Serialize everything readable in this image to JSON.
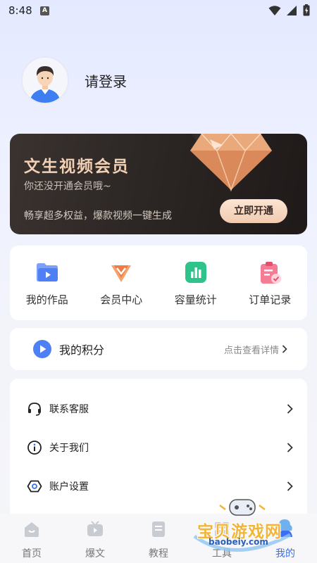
{
  "status_bar": {
    "time": "8:48",
    "notification_badge": "A"
  },
  "profile": {
    "login_text": "请登录"
  },
  "vip_card": {
    "title": "文生视频会员",
    "subtitle": "你还没开通会员哦~",
    "description": "畅享超多权益，爆款视频一键生成",
    "button_label": "立即开通"
  },
  "shortcuts": [
    {
      "label": "我的作品",
      "icon": "folder-video-icon",
      "color": "#5b86f7"
    },
    {
      "label": "会员中心",
      "icon": "vip-v-icon",
      "color": "#f07b45"
    },
    {
      "label": "容量统计",
      "icon": "bar-chart-icon",
      "color": "#2ec38a"
    },
    {
      "label": "订单记录",
      "icon": "order-clipboard-icon",
      "color": "#f05a78"
    }
  ],
  "points": {
    "title": "我的积分",
    "link_text": "点击查看详情"
  },
  "menu": [
    {
      "label": "联系客服",
      "icon": "headset-icon"
    },
    {
      "label": "关于我们",
      "icon": "info-icon"
    },
    {
      "label": "账户设置",
      "icon": "settings-icon"
    }
  ],
  "tabbar": {
    "tabs": [
      {
        "label": "首页",
        "icon": "home-icon"
      },
      {
        "label": "爆文",
        "icon": "tv-icon"
      },
      {
        "label": "教程",
        "icon": "book-icon"
      },
      {
        "label": "工具",
        "icon": "tools-icon"
      },
      {
        "label": "我的",
        "icon": "profile-icon"
      }
    ],
    "active_index": 4,
    "active_color": "#3b6ef5"
  },
  "watermark": {
    "text": "宝贝游戏网",
    "url": "baobeiy.com"
  }
}
